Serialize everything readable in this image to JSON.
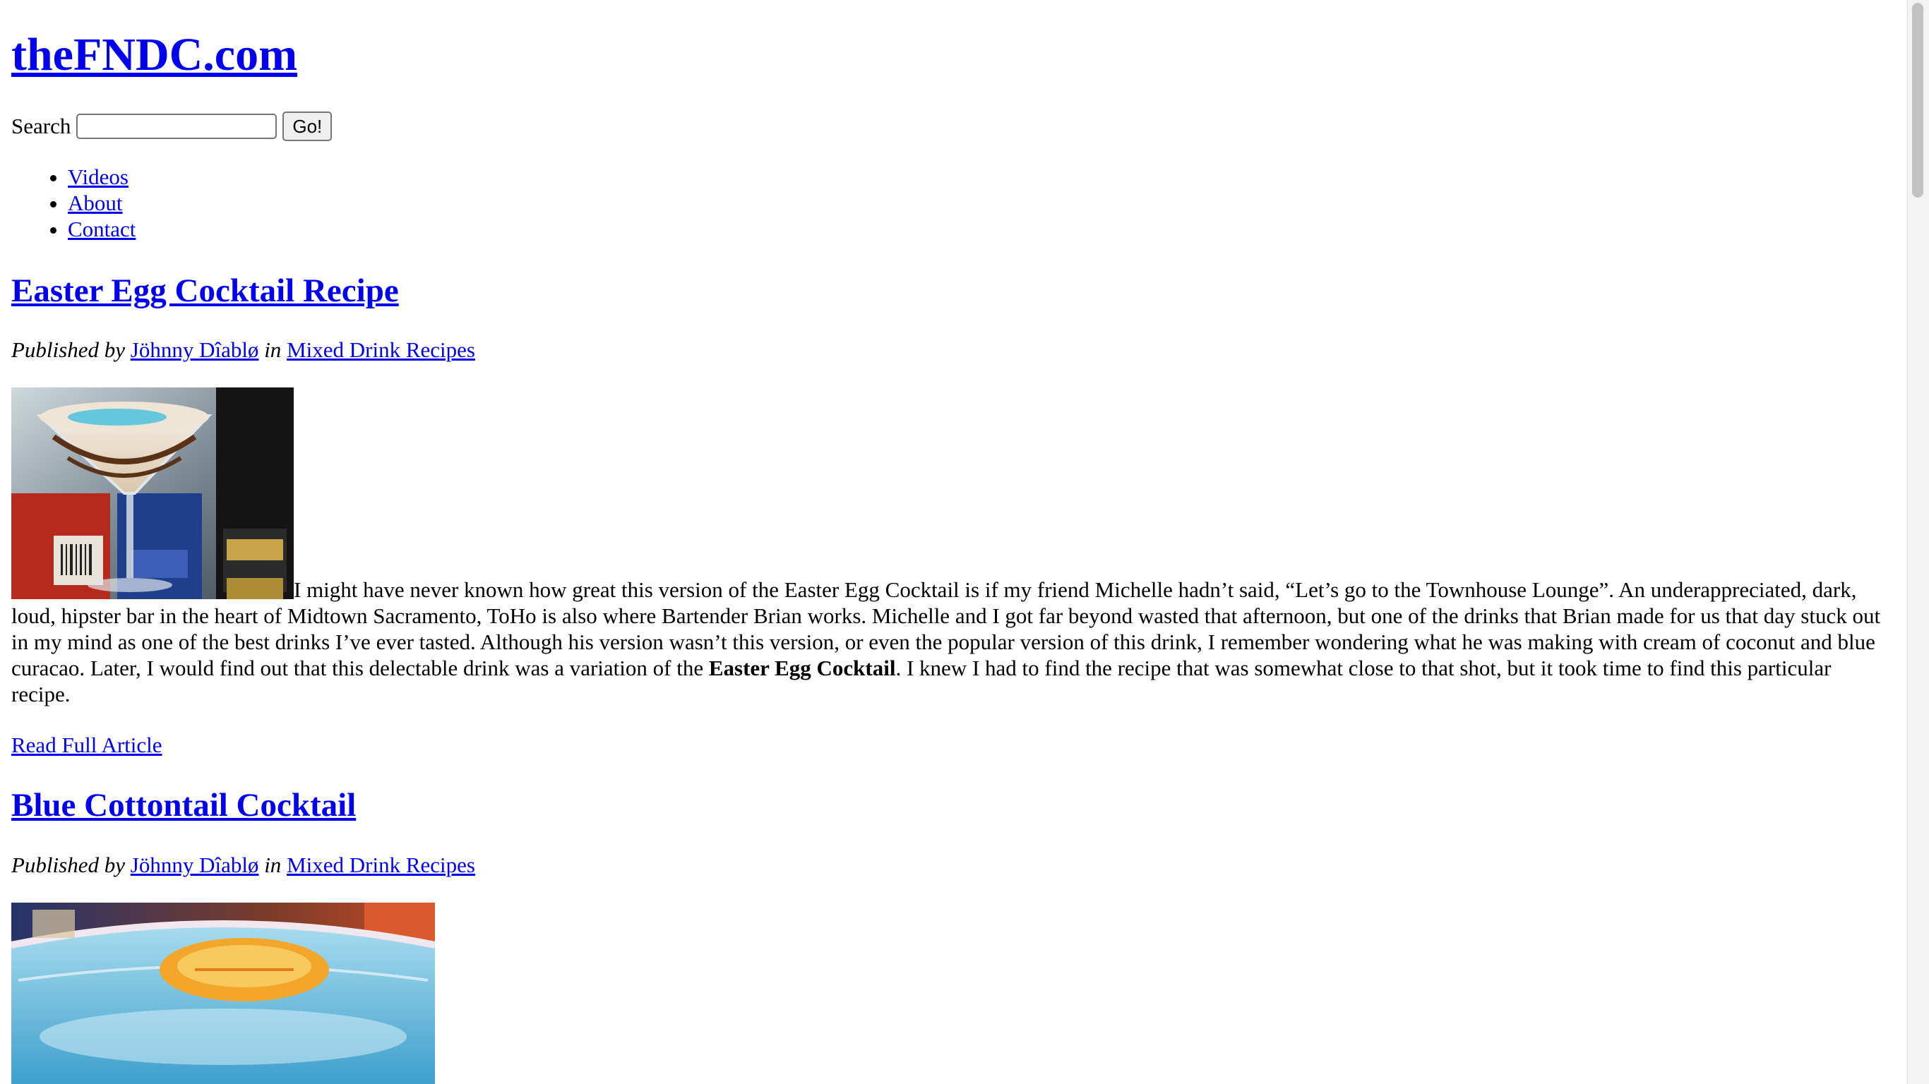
{
  "site": {
    "title": "theFNDC.com"
  },
  "search": {
    "label": "Search",
    "value": "",
    "placeholder": "",
    "button": "Go!"
  },
  "nav": [
    {
      "label": "Videos"
    },
    {
      "label": "About"
    },
    {
      "label": "Contact"
    }
  ],
  "posts": [
    {
      "title": "Easter Egg Cocktail Recipe",
      "byline_prefix": "Published by",
      "author": "Jöhnny Dîablø",
      "in_word": "in",
      "category": "Mixed Drink Recipes",
      "image_alt": "",
      "excerpt_before": "I might have never known how great this version of the Easter Egg Cocktail is if my friend Michelle hadn’t said, “Let’s go to the Townhouse Lounge”. An underappreciated, dark, loud, hipster bar in the heart of Midtown Sacramento, ToHo is also where Bartender Brian works. Michelle and I got far beyond wasted that afternoon, but one of the drinks that Brian made for us that day stuck out in my mind as one of the best drinks I’ve ever tasted. Although his version wasn’t this version, or even the popular version of this drink, I remember wondering what he was making with cream of coconut and blue curacao. Later, I would find out that this delectable drink was a variation of the ",
      "excerpt_bold": "Easter Egg Cocktail",
      "excerpt_after": ". I knew I had to find the recipe that was somewhat close to that shot, but it took time to find this particular recipe.",
      "read_more": "Read Full Article"
    },
    {
      "title": "Blue Cottontail Cocktail",
      "byline_prefix": "Published by",
      "author": "Jöhnny Dîablø",
      "in_word": "in",
      "category": "Mixed Drink Recipes",
      "image_alt": ""
    }
  ],
  "colors": {
    "link": "#0000ee",
    "background": "#ffffff",
    "text": "#000000"
  }
}
